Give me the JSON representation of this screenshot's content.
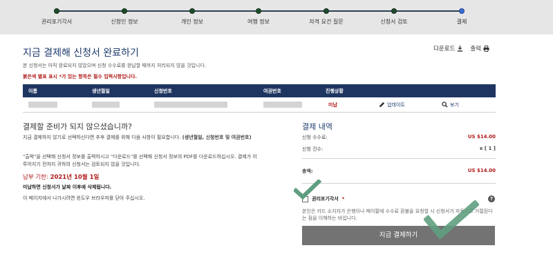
{
  "progress": {
    "steps": [
      {
        "label": "권리포기각서",
        "current": false
      },
      {
        "label": "신청인 정보",
        "current": false
      },
      {
        "label": "개인 정보",
        "current": false
      },
      {
        "label": "여행 정보",
        "current": false
      },
      {
        "label": "자격 요건 질문",
        "current": false
      },
      {
        "label": "신청서 검토",
        "current": false
      },
      {
        "label": "결제",
        "current": true
      }
    ]
  },
  "header": {
    "title": "지금 결제해 신청서 완료하기",
    "subtitle": "본 신청서는 아직 완료되지 않았으며 신청 수수료를 완납할 때까지 처리되지 않을 것입니다.",
    "required_note": "붉은색 별표 표시 *가 있는 항목은 필수 입력사항입니다.",
    "download_label": "다운로드",
    "print_label": "출력"
  },
  "table": {
    "headers": [
      "이름",
      "생년월일",
      "신청번호",
      "여권번호",
      "진행상황"
    ],
    "row": {
      "status": "미납",
      "update_label": "업데이트",
      "view_label": "보기"
    }
  },
  "left": {
    "heading": "결제할 준비가 되지 않으셨습니까?",
    "para1_a": "지금 결제하지 않기로 선택하신다면 추후 결제를 위해 다음 사항이 필요합니다. ",
    "para1_b": "(생년월일, 신청번호 및 여권번호)",
    "para2": "\"출력\"을 선택해 신청서 정보를 출력하시고 \"다운로드\"를 선택해 신청서 정보의 PDF를 다운로드하십시오. 결제가 이루어지기 전까지 귀하의 신청서는 검토되지 않을 것입니다.",
    "deadline_label": "납부 기한: ",
    "deadline_date": "2021년 10월 1일",
    "delete_note": "미납하면 신청서가 날짜 이후에 삭제됩니다.",
    "exit_note": "이 페이지에서 나가시려면 윈도우 브라우저를 닫아 주십시오."
  },
  "payment": {
    "heading": "결제 내역",
    "fee_label": "신청 수수료:",
    "fee_value": "US $14.00",
    "count_label": "신청 건수:",
    "count_value": "x [ 1 ]",
    "total_label": "총액:",
    "total_value": "US $14.00",
    "waiver_label": "권리포기각서",
    "waiver_star": "*",
    "help_symbol": "?",
    "waiver_text": "본인은 카드 소지자가 은행이나 페이팔에 수수료 환불을 요청할 시 신청서가 자동으로 거절된다는 점을 이해하는 바입니다.",
    "pay_button": "지금 결제하기"
  },
  "colors": {
    "navy": "#1f3561",
    "red": "#b01a1a",
    "check_green": "#5f9e80",
    "button_gray": "#737373"
  }
}
